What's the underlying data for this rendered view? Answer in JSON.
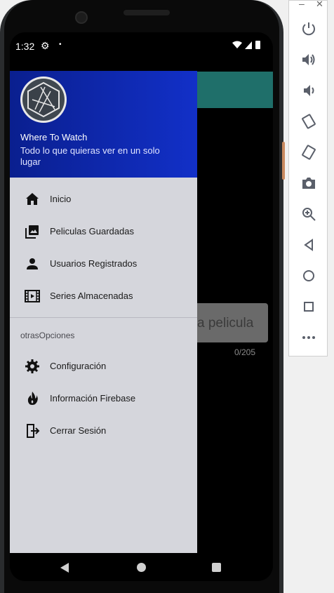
{
  "status_bar": {
    "time": "1:32",
    "settings_glyph": "⚙",
    "dot": "•",
    "right_icons": "▾◢▮"
  },
  "background": {
    "input_placeholder": "a pelicula",
    "counter": "0/205"
  },
  "drawer": {
    "app_name": "Where To Watch",
    "app_subtitle": "Todo lo que quieras ver en un solo lugar",
    "main_items": [
      {
        "label": "Inicio",
        "icon": "home-icon"
      },
      {
        "label": "Peliculas Guardadas",
        "icon": "photo-library-icon"
      },
      {
        "label": "Usuarios Registrados",
        "icon": "person-icon"
      },
      {
        "label": "Series Almacenadas",
        "icon": "movie-icon"
      }
    ],
    "section_title": "otrasOpciones",
    "other_items": [
      {
        "label": "Configuración",
        "icon": "gear-icon"
      },
      {
        "label": "Información Firebase",
        "icon": "fire-icon"
      },
      {
        "label": "Cerrar Sesión",
        "icon": "logout-icon"
      }
    ]
  },
  "emulator_toolbar": {
    "minimize": "–",
    "close": "✕",
    "buttons": [
      "power-icon",
      "volume-up-icon",
      "volume-down-icon",
      "rotate-left-icon",
      "rotate-right-icon",
      "camera-icon",
      "zoom-icon",
      "back-icon",
      "home-icon",
      "overview-icon",
      "more-icon"
    ]
  },
  "colors": {
    "header_start": "#0a1f8f",
    "header_end": "#1230c8",
    "drawer_bg": "#d5d6dc",
    "appbar": "#1f6f6a"
  }
}
